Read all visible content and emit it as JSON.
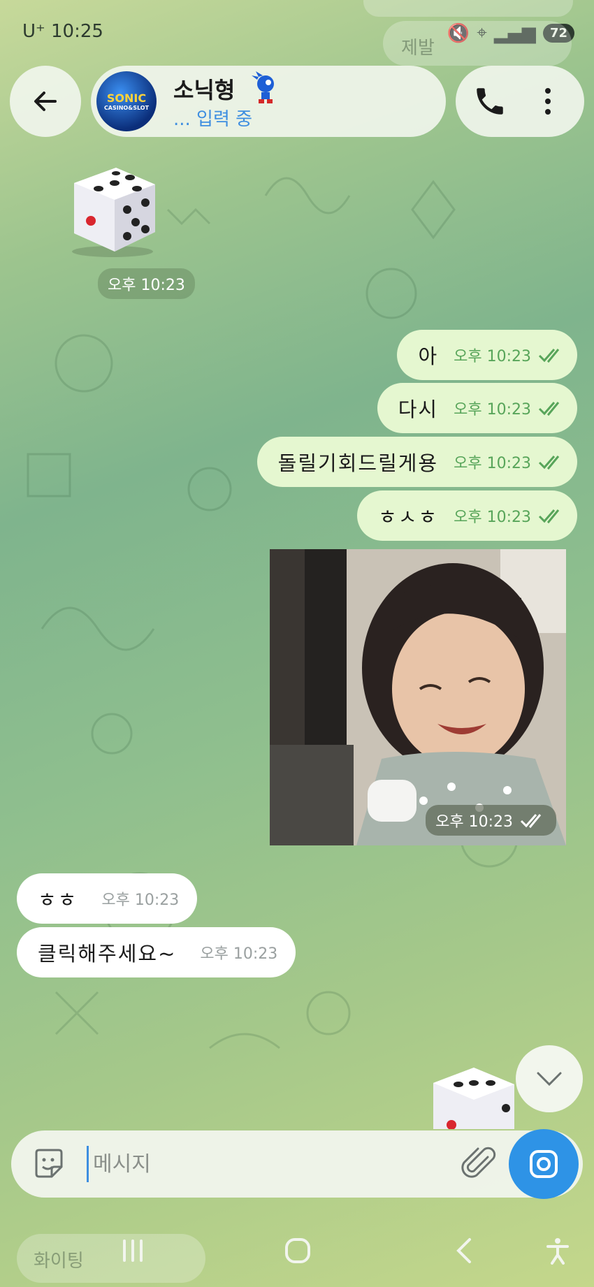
{
  "status_bar": {
    "carrier_time": "U⁺ 10:25",
    "battery": "72"
  },
  "ghost": {
    "top_preview": "제발",
    "bottom_preview": "화이팅"
  },
  "header": {
    "contact_name": "소닉형",
    "typing_status": "... 입력 중",
    "avatar_text": "SONIC",
    "avatar_subtext": "CASINO&SLOT"
  },
  "messages": {
    "dice_time": "오후 10:23",
    "outgoing": [
      {
        "text": "아",
        "time": "오후 10:23"
      },
      {
        "text": "다시",
        "time": "오후 10:23"
      },
      {
        "text": "돌릴기회드릴게용",
        "time": "오후 10:23"
      },
      {
        "text": "ㅎㅅㅎ",
        "time": "오후 10:23"
      }
    ],
    "photo_time": "오후 10:23",
    "incoming": [
      {
        "text": "ㅎㅎ",
        "time": "오후 10:23"
      },
      {
        "text": "클릭해주세요~",
        "time": "오후 10:23"
      }
    ]
  },
  "composer": {
    "placeholder": "메시지"
  },
  "colors": {
    "accent": "#2e93e6",
    "outgoing_bubble": "#e5f7d0",
    "incoming_bubble": "#ffffff",
    "check_color": "#58a55a"
  },
  "icons": [
    "back-arrow-icon",
    "phone-icon",
    "more-vert-icon",
    "check-double-icon",
    "chevron-down-icon",
    "sticker-icon",
    "paperclip-icon",
    "camera-icon",
    "recents-icon",
    "home-icon",
    "back-icon",
    "accessibility-icon"
  ]
}
